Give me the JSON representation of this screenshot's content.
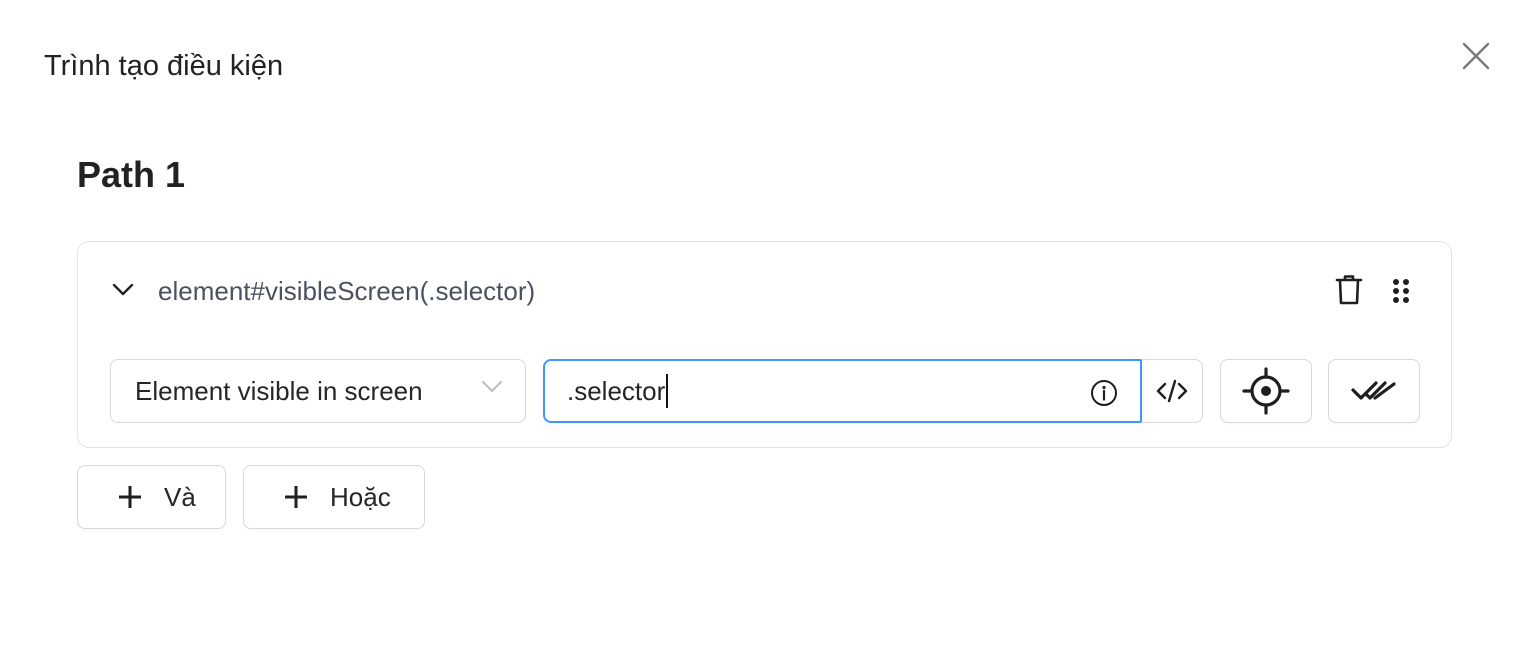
{
  "dialog": {
    "title": "Trình tạo điều kiện",
    "close_icon": "close-icon"
  },
  "path": {
    "title": "Path 1"
  },
  "condition": {
    "label": "element#visibleScreen(.selector)",
    "type_select": {
      "selected": "Element visible in screen"
    },
    "selector_input": {
      "value": ".selector"
    },
    "icons": {
      "expand": "chevron-down-icon",
      "delete": "trash-icon",
      "drag": "drag-handle-icon",
      "info": "info-icon",
      "code": "code-icon",
      "pick": "crosshair-icon",
      "verify": "double-check-icon"
    }
  },
  "actions": {
    "and_label": "Và",
    "or_label": "Hoặc"
  },
  "colors": {
    "focus_border": "#4096ff",
    "border": "#d9d9d9",
    "card_border": "#e3e3e3",
    "label_text": "#4a5160"
  }
}
